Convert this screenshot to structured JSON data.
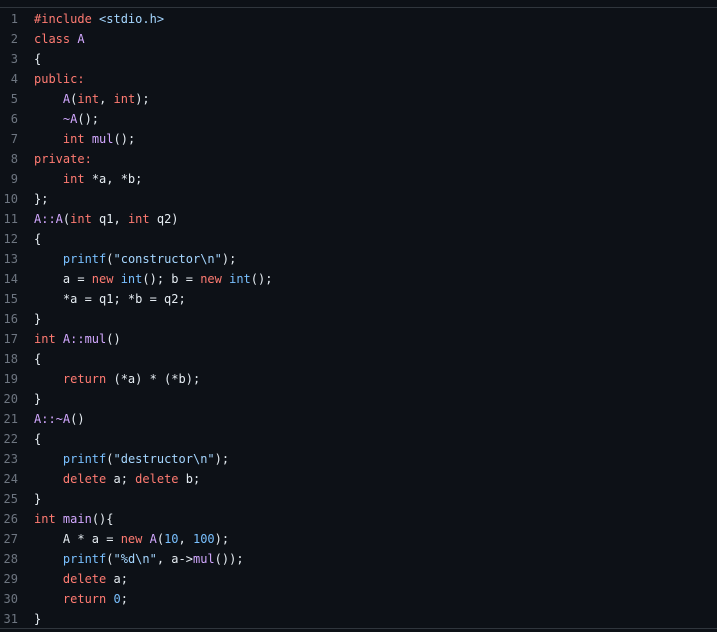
{
  "editor": {
    "lines": [
      {
        "number": "1",
        "tokens": [
          {
            "text": "#include ",
            "kind": "keyword"
          },
          {
            "text": "<stdio.h>",
            "kind": "string"
          }
        ]
      },
      {
        "number": "2",
        "tokens": [
          {
            "text": "class ",
            "kind": "keyword"
          },
          {
            "text": "A",
            "kind": "function"
          }
        ]
      },
      {
        "number": "3",
        "tokens": [
          {
            "text": "{",
            "kind": "plain"
          }
        ]
      },
      {
        "number": "4",
        "tokens": [
          {
            "text": "public:",
            "kind": "keyword"
          }
        ]
      },
      {
        "number": "5",
        "tokens": [
          {
            "text": "    ",
            "kind": "plain"
          },
          {
            "text": "A",
            "kind": "function"
          },
          {
            "text": "(",
            "kind": "plain"
          },
          {
            "text": "int",
            "kind": "keyword"
          },
          {
            "text": ", ",
            "kind": "plain"
          },
          {
            "text": "int",
            "kind": "keyword"
          },
          {
            "text": ");",
            "kind": "plain"
          }
        ]
      },
      {
        "number": "6",
        "tokens": [
          {
            "text": "    ",
            "kind": "plain"
          },
          {
            "text": "~A",
            "kind": "function"
          },
          {
            "text": "();",
            "kind": "plain"
          }
        ]
      },
      {
        "number": "7",
        "tokens": [
          {
            "text": "    ",
            "kind": "plain"
          },
          {
            "text": "int ",
            "kind": "keyword"
          },
          {
            "text": "mul",
            "kind": "function"
          },
          {
            "text": "();",
            "kind": "plain"
          }
        ]
      },
      {
        "number": "8",
        "tokens": [
          {
            "text": "private:",
            "kind": "keyword"
          }
        ]
      },
      {
        "number": "9",
        "tokens": [
          {
            "text": "    ",
            "kind": "plain"
          },
          {
            "text": "int ",
            "kind": "keyword"
          },
          {
            "text": "*a, *b;",
            "kind": "plain"
          }
        ]
      },
      {
        "number": "10",
        "tokens": [
          {
            "text": "};",
            "kind": "plain"
          }
        ]
      },
      {
        "number": "11",
        "tokens": [
          {
            "text": "A::A",
            "kind": "function"
          },
          {
            "text": "(",
            "kind": "plain"
          },
          {
            "text": "int ",
            "kind": "keyword"
          },
          {
            "text": "q1, ",
            "kind": "plain"
          },
          {
            "text": "int ",
            "kind": "keyword"
          },
          {
            "text": "q2)",
            "kind": "plain"
          }
        ]
      },
      {
        "number": "12",
        "tokens": [
          {
            "text": "{",
            "kind": "plain"
          }
        ]
      },
      {
        "number": "13",
        "tokens": [
          {
            "text": "    ",
            "kind": "plain"
          },
          {
            "text": "printf",
            "kind": "builtin"
          },
          {
            "text": "(",
            "kind": "plain"
          },
          {
            "text": "\"constructor\\n\"",
            "kind": "string"
          },
          {
            "text": ");",
            "kind": "plain"
          }
        ]
      },
      {
        "number": "14",
        "tokens": [
          {
            "text": "    a = ",
            "kind": "plain"
          },
          {
            "text": "new ",
            "kind": "keyword"
          },
          {
            "text": "int",
            "kind": "builtin"
          },
          {
            "text": "(); b = ",
            "kind": "plain"
          },
          {
            "text": "new ",
            "kind": "keyword"
          },
          {
            "text": "int",
            "kind": "builtin"
          },
          {
            "text": "();",
            "kind": "plain"
          }
        ]
      },
      {
        "number": "15",
        "tokens": [
          {
            "text": "    *a = q1; *b = q2;",
            "kind": "plain"
          }
        ]
      },
      {
        "number": "16",
        "tokens": [
          {
            "text": "}",
            "kind": "plain"
          }
        ]
      },
      {
        "number": "17",
        "tokens": [
          {
            "text": "int ",
            "kind": "keyword"
          },
          {
            "text": "A::mul",
            "kind": "function"
          },
          {
            "text": "()",
            "kind": "plain"
          }
        ]
      },
      {
        "number": "18",
        "tokens": [
          {
            "text": "{",
            "kind": "plain"
          }
        ]
      },
      {
        "number": "19",
        "tokens": [
          {
            "text": "    ",
            "kind": "plain"
          },
          {
            "text": "return ",
            "kind": "keyword"
          },
          {
            "text": "(*a) * (*b);",
            "kind": "plain"
          }
        ]
      },
      {
        "number": "20",
        "tokens": [
          {
            "text": "}",
            "kind": "plain"
          }
        ]
      },
      {
        "number": "21",
        "tokens": [
          {
            "text": "A::~A",
            "kind": "function"
          },
          {
            "text": "()",
            "kind": "plain"
          }
        ]
      },
      {
        "number": "22",
        "tokens": [
          {
            "text": "{",
            "kind": "plain"
          }
        ]
      },
      {
        "number": "23",
        "tokens": [
          {
            "text": "    ",
            "kind": "plain"
          },
          {
            "text": "printf",
            "kind": "builtin"
          },
          {
            "text": "(",
            "kind": "plain"
          },
          {
            "text": "\"destructor\\n\"",
            "kind": "string"
          },
          {
            "text": ");",
            "kind": "plain"
          }
        ]
      },
      {
        "number": "24",
        "tokens": [
          {
            "text": "    ",
            "kind": "plain"
          },
          {
            "text": "delete ",
            "kind": "keyword"
          },
          {
            "text": "a; ",
            "kind": "plain"
          },
          {
            "text": "delete ",
            "kind": "keyword"
          },
          {
            "text": "b;",
            "kind": "plain"
          }
        ]
      },
      {
        "number": "25",
        "tokens": [
          {
            "text": "}",
            "kind": "plain"
          }
        ]
      },
      {
        "number": "26",
        "tokens": [
          {
            "text": "int ",
            "kind": "keyword"
          },
          {
            "text": "main",
            "kind": "function"
          },
          {
            "text": "(){",
            "kind": "plain"
          }
        ]
      },
      {
        "number": "27",
        "tokens": [
          {
            "text": "    A * a = ",
            "kind": "plain"
          },
          {
            "text": "new ",
            "kind": "keyword"
          },
          {
            "text": "A",
            "kind": "function"
          },
          {
            "text": "(",
            "kind": "plain"
          },
          {
            "text": "10",
            "kind": "number"
          },
          {
            "text": ", ",
            "kind": "plain"
          },
          {
            "text": "100",
            "kind": "number"
          },
          {
            "text": ");",
            "kind": "plain"
          }
        ]
      },
      {
        "number": "28",
        "tokens": [
          {
            "text": "    ",
            "kind": "plain"
          },
          {
            "text": "printf",
            "kind": "builtin"
          },
          {
            "text": "(",
            "kind": "plain"
          },
          {
            "text": "\"%d\\n\"",
            "kind": "string"
          },
          {
            "text": ", a->",
            "kind": "plain"
          },
          {
            "text": "mul",
            "kind": "function"
          },
          {
            "text": "());",
            "kind": "plain"
          }
        ]
      },
      {
        "number": "29",
        "tokens": [
          {
            "text": "    ",
            "kind": "plain"
          },
          {
            "text": "delete ",
            "kind": "keyword"
          },
          {
            "text": "a;",
            "kind": "plain"
          }
        ]
      },
      {
        "number": "30",
        "tokens": [
          {
            "text": "    ",
            "kind": "plain"
          },
          {
            "text": "return ",
            "kind": "keyword"
          },
          {
            "text": "0",
            "kind": "number"
          },
          {
            "text": ";",
            "kind": "plain"
          }
        ]
      },
      {
        "number": "31",
        "tokens": [
          {
            "text": "}",
            "kind": "plain"
          }
        ]
      }
    ]
  }
}
